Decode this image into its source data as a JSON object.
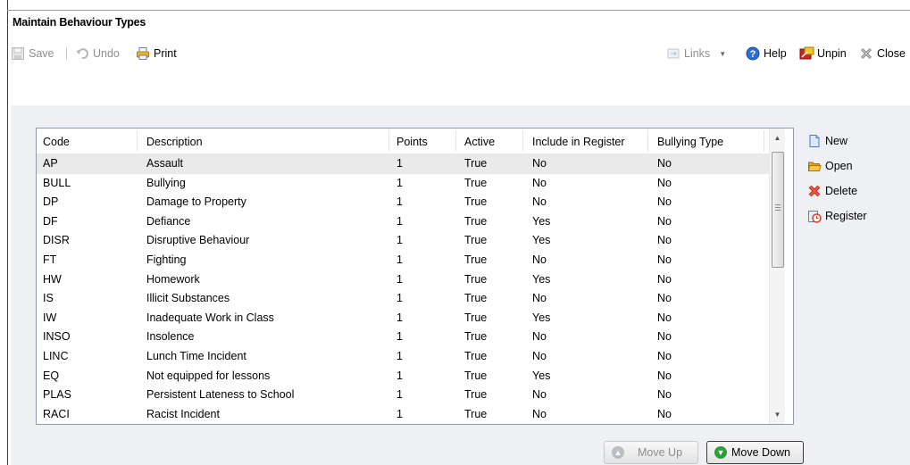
{
  "window": {
    "title": "Maintain Behaviour Types"
  },
  "toolbar": {
    "save_label": "Save",
    "undo_label": "Undo",
    "print_label": "Print",
    "links_label": "Links",
    "help_label": "Help",
    "unpin_label": "Unpin",
    "close_label": "Close"
  },
  "grid": {
    "headers": {
      "code": "Code",
      "description": "Description",
      "points": "Points",
      "active": "Active",
      "include": "Include in Register",
      "bullying": "Bullying Type"
    },
    "rows": [
      {
        "code": "AP",
        "description": "Assault",
        "points": "1",
        "active": "True",
        "include": "No",
        "bullying": "No"
      },
      {
        "code": "BULL",
        "description": "Bullying",
        "points": "1",
        "active": "True",
        "include": "No",
        "bullying": "No"
      },
      {
        "code": "DP",
        "description": "Damage to Property",
        "points": "1",
        "active": "True",
        "include": "No",
        "bullying": "No"
      },
      {
        "code": "DF",
        "description": "Defiance",
        "points": "1",
        "active": "True",
        "include": "Yes",
        "bullying": "No"
      },
      {
        "code": "DISR",
        "description": "Disruptive Behaviour",
        "points": "1",
        "active": "True",
        "include": "Yes",
        "bullying": "No"
      },
      {
        "code": "FT",
        "description": "Fighting",
        "points": "1",
        "active": "True",
        "include": "No",
        "bullying": "No"
      },
      {
        "code": "HW",
        "description": "Homework",
        "points": "1",
        "active": "True",
        "include": "Yes",
        "bullying": "No"
      },
      {
        "code": "IS",
        "description": "Illicit Substances",
        "points": "1",
        "active": "True",
        "include": "No",
        "bullying": "No"
      },
      {
        "code": "IW",
        "description": "Inadequate Work in Class",
        "points": "1",
        "active": "True",
        "include": "Yes",
        "bullying": "No"
      },
      {
        "code": "INSO",
        "description": "Insolence",
        "points": "1",
        "active": "True",
        "include": "No",
        "bullying": "No"
      },
      {
        "code": "LINC",
        "description": "Lunch Time Incident",
        "points": "1",
        "active": "True",
        "include": "No",
        "bullying": "No"
      },
      {
        "code": "EQ",
        "description": "Not equipped for lessons",
        "points": "1",
        "active": "True",
        "include": "Yes",
        "bullying": "No"
      },
      {
        "code": "PLAS",
        "description": "Persistent Lateness to School",
        "points": "1",
        "active": "True",
        "include": "No",
        "bullying": "No"
      },
      {
        "code": "RACI",
        "description": "Racist Incident",
        "points": "1",
        "active": "True",
        "include": "No",
        "bullying": "No"
      }
    ]
  },
  "side_actions": {
    "new_label": "New",
    "open_label": "Open",
    "delete_label": "Delete",
    "register_label": "Register"
  },
  "footer": {
    "move_up_label": "Move Up",
    "move_down_label": "Move Down"
  },
  "colors": {
    "accent_blue": "#2a6fd6",
    "delete_red": "#d93a2b",
    "move_green": "#2e9e3a"
  }
}
